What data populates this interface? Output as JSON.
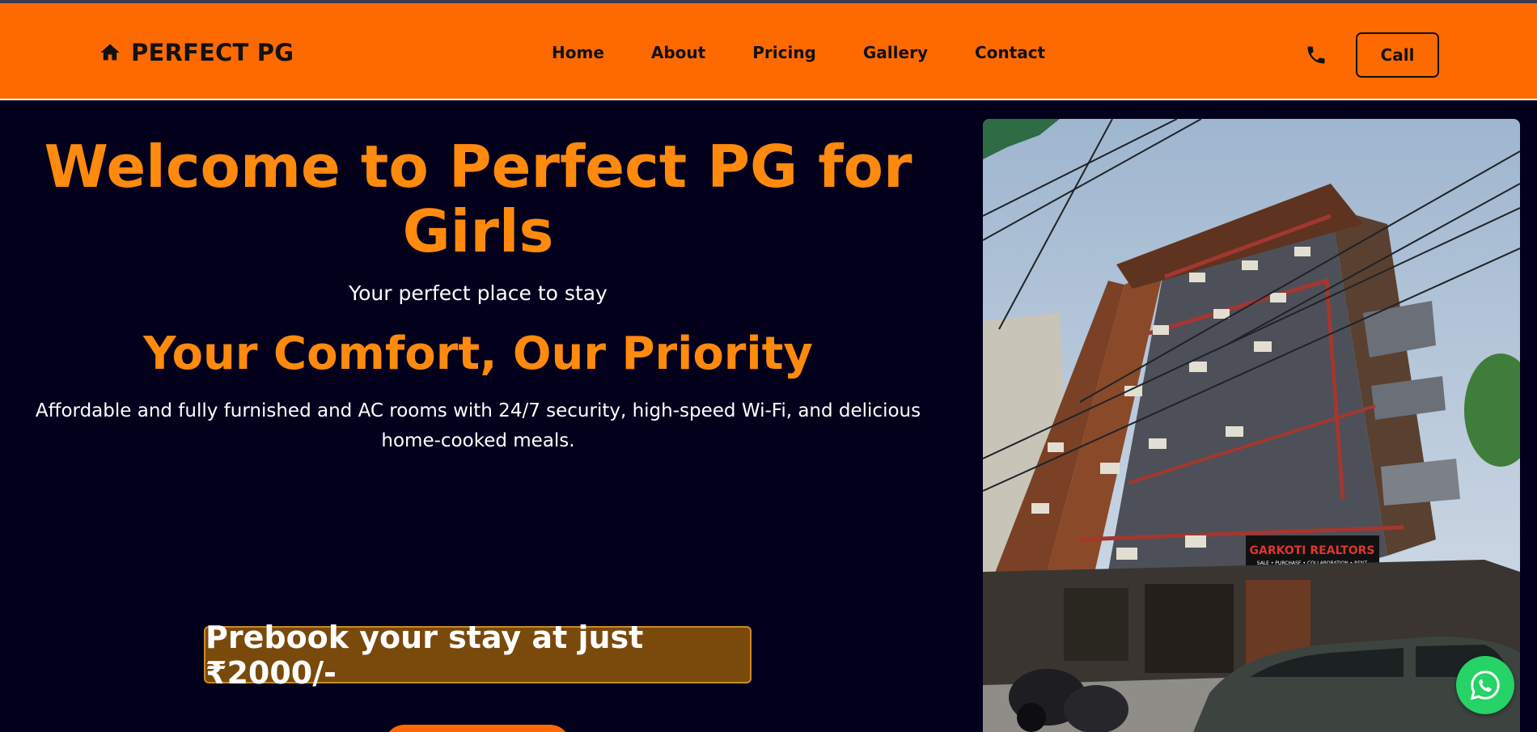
{
  "navbar": {
    "brand_icon": "home-icon",
    "brand_name": "PERFECT PG",
    "links": [
      {
        "label": "Home"
      },
      {
        "label": "About"
      },
      {
        "label": "Pricing"
      },
      {
        "label": "Gallery"
      },
      {
        "label": "Contact"
      }
    ],
    "phone_icon": "phone-icon",
    "call_label": "Call"
  },
  "hero": {
    "title": "Welcome to Perfect PG for Girls",
    "subtitle": "Your perfect place to stay",
    "heading": "Your Comfort, Our Priority",
    "description": "Affordable and fully furnished and AC rooms with 24/7 security, high-speed Wi-Fi, and delicious home-cooked meals.",
    "prebook": "Prebook your stay at just ₹2000/-",
    "photo_sign": "GARKOTI REALTORS",
    "photo_sign_sub": "SALE • PURCHASE • COLLABORATION • RENT"
  },
  "floating": {
    "whatsapp_icon": "whatsapp-icon"
  },
  "colors": {
    "navbar_bg": "#ff6a00",
    "page_bg": "#03001c",
    "accent_text": "#ff8a0d",
    "prebook_bg": "#7a4a0c",
    "whatsapp": "#25d366"
  }
}
